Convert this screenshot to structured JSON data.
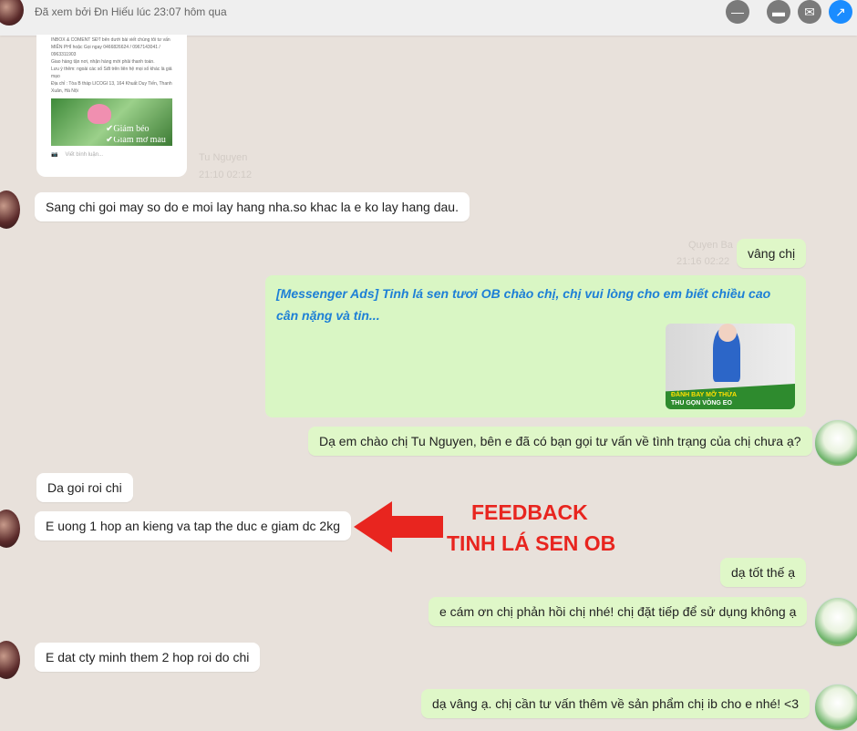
{
  "header": {
    "seen_text": "Đã xem bởi Đn Hiếu lúc 23:07 hôm qua",
    "icons": [
      "minus-circle-icon",
      "inbox-icon",
      "mail-icon",
      "open-external-icon"
    ],
    "accent": "#1a8cff"
  },
  "post_card": {
    "lines": [
      "INBOX & COMENT SĐT bên dưới bài viết chúng tôi tư vấn MIỄN PHÍ hoặc Gọi ngay 0466826624 / 0967143041 / 0963311903",
      "Giao hàng tận nơi, nhận hàng mới phải thanh toán.",
      "Lưu ý thêm: ngoài các số Sđt trên liên hệ mọi số khác là giả mạo",
      "Địa chỉ : Tòa B tháp LICOGI 13, 164 Khuất Duy Tiến, Thanh Xuân, Hà Nội"
    ],
    "image_text": [
      "✔Giảm béo",
      "✔Giảm mỡ máu"
    ],
    "comment_placeholder": "Viết bình luận..."
  },
  "meta1": {
    "name": "Tu Nguyen",
    "time": "21:10 02:12"
  },
  "meta2": {
    "name": "Quyen Ba",
    "time": "21:16 02:22"
  },
  "messages": [
    {
      "dir": "in",
      "text": "Sang chi goi may so do e moi lay hang nha.so khac la e ko lay hang dau."
    },
    {
      "dir": "out",
      "text": "vâng chị"
    },
    {
      "dir": "out",
      "text": "Dạ em chào chị Tu Nguyen, bên e đã có bạn gọi tư vấn về tình trạng của chị chưa ạ?"
    },
    {
      "dir": "in",
      "text": "Da goi roi chi"
    },
    {
      "dir": "in",
      "text": "E uong 1 hop an kieng va tap the duc e giam dc 2kg"
    },
    {
      "dir": "out",
      "text": "dạ tốt thế ạ"
    },
    {
      "dir": "out",
      "text": "e cám ơn chị phản hồi chị nhé! chị đặt tiếp để sử dụng không ạ"
    },
    {
      "dir": "in",
      "text": "E dat cty minh them 2 hop roi do chi"
    },
    {
      "dir": "out",
      "text": "dạ vâng ạ. chị cần tư vấn thêm về sản phẩm chị ib cho e nhé! <3"
    }
  ],
  "ad": {
    "text": "[Messenger Ads] Tinh lá sen tươi OB chào chị, chị vui lòng cho em biết chiều cao cân nặng và tin...",
    "image_text": [
      "ĐÁNH BAY MỠ THỪA",
      "THU GỌN VÒNG EO"
    ]
  },
  "annotation": {
    "line1": "FEEDBACK",
    "line2": "TINH LÁ SEN OB",
    "color": "#e8251f"
  }
}
